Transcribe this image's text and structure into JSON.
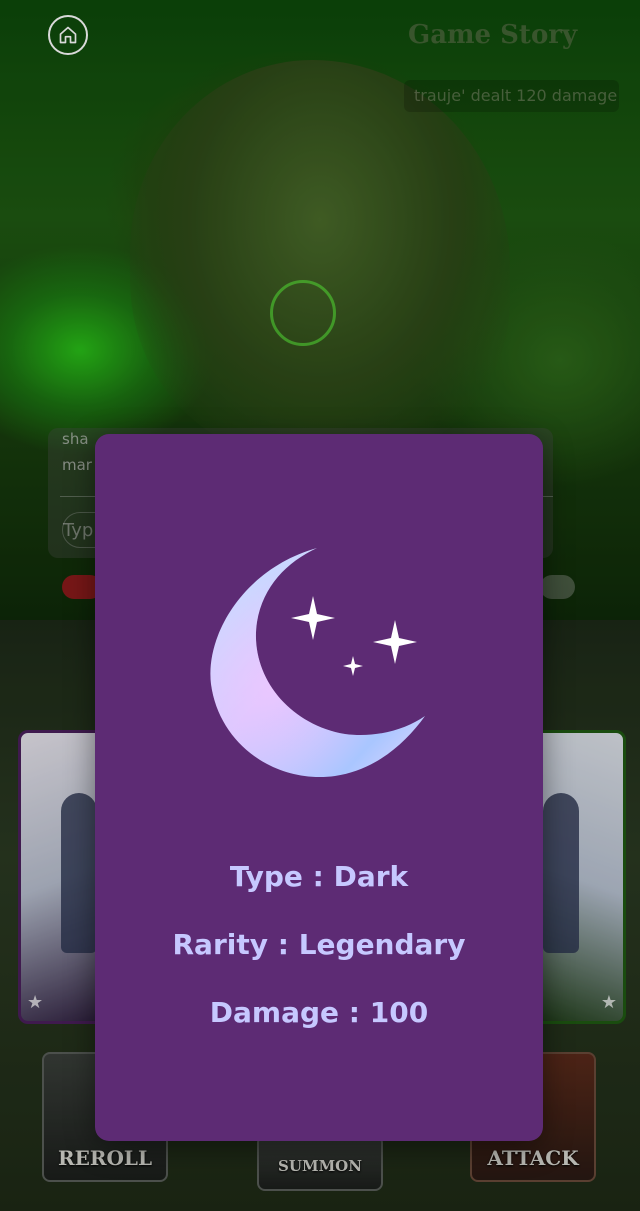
{
  "header": {
    "home_icon": "home-icon",
    "title": "Game Story"
  },
  "story_log": {
    "text": "trauje' dealt 120 damage"
  },
  "chat": {
    "line1": "sha",
    "line2": "mar",
    "input_placeholder": "Typ"
  },
  "side_cards": {
    "left_star_icon": "star-icon",
    "right_star_icon": "star-icon"
  },
  "actions": {
    "reroll_label": "REROLL",
    "summon_label": "SUMMON",
    "attack_label": "ATTACK"
  },
  "card_detail": {
    "icon": "crescent-moon-stars-icon",
    "type": "Type : Dark",
    "rarity": "Rarity : Legendary",
    "damage": "Damage : 100"
  },
  "colors": {
    "modal_bg": "#5d2b74",
    "stat_text": "#c6c8ff"
  }
}
